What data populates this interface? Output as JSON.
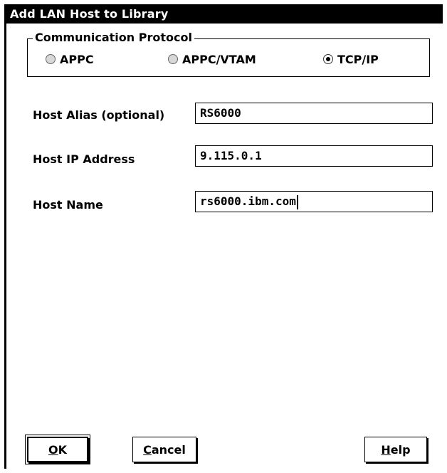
{
  "window": {
    "title": "Add LAN Host to Library"
  },
  "protocol_group": {
    "label": "Communication Protocol",
    "options": [
      {
        "label": "APPC",
        "selected": false
      },
      {
        "label": "APPC/VTAM",
        "selected": false
      },
      {
        "label": "TCP/IP",
        "selected": true
      }
    ]
  },
  "fields": {
    "host_alias": {
      "label": "Host Alias (optional)",
      "value": "RS6000"
    },
    "host_ip": {
      "label": "Host IP Address",
      "value": "9.115.0.1"
    },
    "host_name": {
      "label": "Host Name",
      "value": "rs6000.ibm.com"
    }
  },
  "buttons": {
    "ok": {
      "mnemonic": "O",
      "rest": "K"
    },
    "cancel": {
      "mnemonic": "C",
      "rest": "ancel"
    },
    "help": {
      "mnemonic": "H",
      "rest": "elp"
    }
  }
}
